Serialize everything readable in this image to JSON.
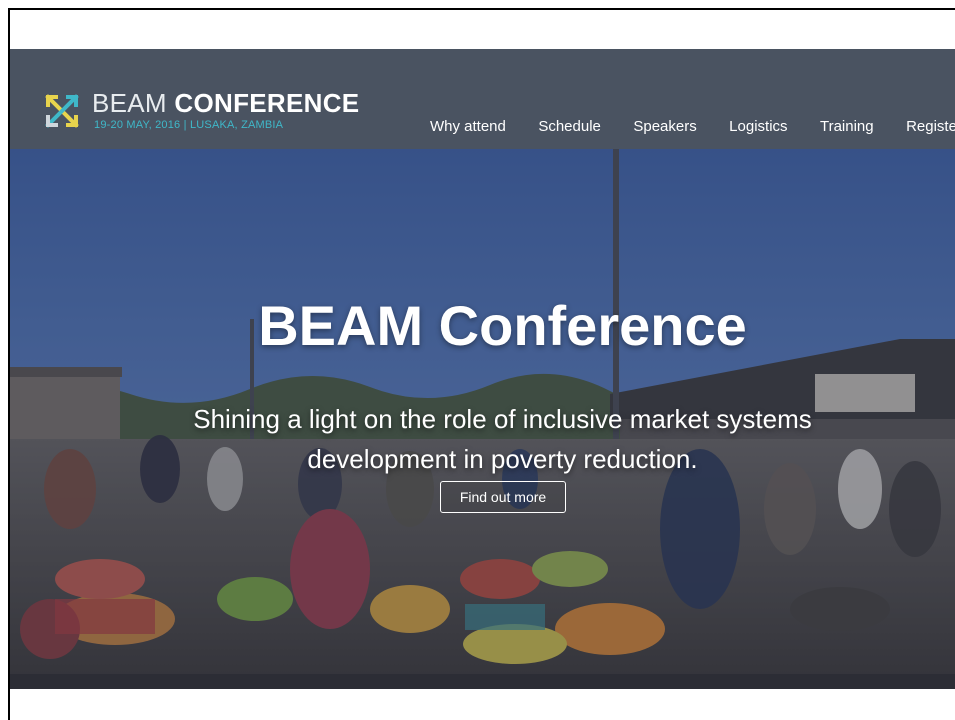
{
  "brand": {
    "title_light": "BEAM",
    "title_bold": "CONFERENCE",
    "subtitle": "19-20 MAY, 2016 | LUSAKA, ZAMBIA",
    "logo_icon": "crossed-arrows-logo",
    "colors": {
      "header_bg": "#4a5361",
      "accent_teal": "#3fb8c9",
      "accent_yellow": "#e8d44d"
    }
  },
  "nav": {
    "items": [
      {
        "label": "Why attend"
      },
      {
        "label": "Schedule"
      },
      {
        "label": "Speakers"
      },
      {
        "label": "Logistics"
      },
      {
        "label": "Training"
      },
      {
        "label": "Registe"
      }
    ]
  },
  "hero": {
    "title": "BEAM Conference",
    "tagline": "Shining a light on the role of inclusive market systems development in poverty reduction.",
    "cta_label": "Find out more",
    "background": "market-scene-photo"
  }
}
